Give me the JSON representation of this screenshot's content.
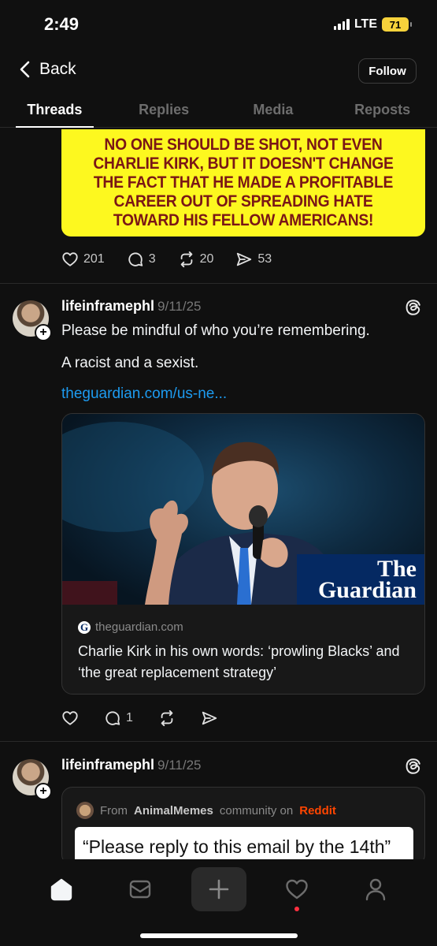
{
  "status_bar": {
    "time": "2:49",
    "network": "LTE",
    "battery": "71"
  },
  "header": {
    "back_label": "Back",
    "follow_label": "Follow"
  },
  "tabs": [
    {
      "label": "Threads",
      "active": true
    },
    {
      "label": "Replies",
      "active": false
    },
    {
      "label": "Media",
      "active": false
    },
    {
      "label": "Reposts",
      "active": false
    }
  ],
  "post1": {
    "image_text": "NO ONE SHOULD BE SHOT, NOT EVEN CHARLIE KIRK, BUT IT DOESN'T CHANGE THE FACT THAT HE MADE A PROFITABLE CAREER OUT OF SPREADING HATE TOWARD HIS FELLOW AMERICANS!",
    "likes": "201",
    "replies": "3",
    "reposts": "20",
    "shares": "53"
  },
  "post2": {
    "username": "lifeinframephl",
    "date": "9/11/25",
    "text_line1": "Please be mindful of who you’re remembering.",
    "text_line2": "A racist and a sexist.",
    "link": "theguardian.com/us-ne...",
    "card": {
      "logo": "The Guardian",
      "domain": "theguardian.com",
      "title": "Charlie Kirk in his own words: ‘prowling Blacks’ and ‘the great replacement strategy’"
    },
    "replies": "1"
  },
  "post3": {
    "username": "lifeinframephl",
    "date": "9/11/25",
    "source_prefix": "From",
    "source_community": "AnimalMemes",
    "source_mid": "community on",
    "source_site": "Reddit",
    "quote": "“Please reply to this email by the 14th”"
  },
  "colors": {
    "link": "#1d9bf0",
    "banner_bg": "#fdf81f",
    "banner_text": "#7a1616",
    "guardian_blue": "#052962",
    "reddit": "#ff4500",
    "notification_dot": "#ff3040"
  },
  "icons": [
    "chevron-left-icon",
    "heart-icon",
    "comment-icon",
    "repost-icon",
    "share-icon",
    "threads-logo-icon",
    "home-icon",
    "inbox-icon",
    "plus-icon",
    "activity-heart-icon",
    "profile-icon"
  ]
}
